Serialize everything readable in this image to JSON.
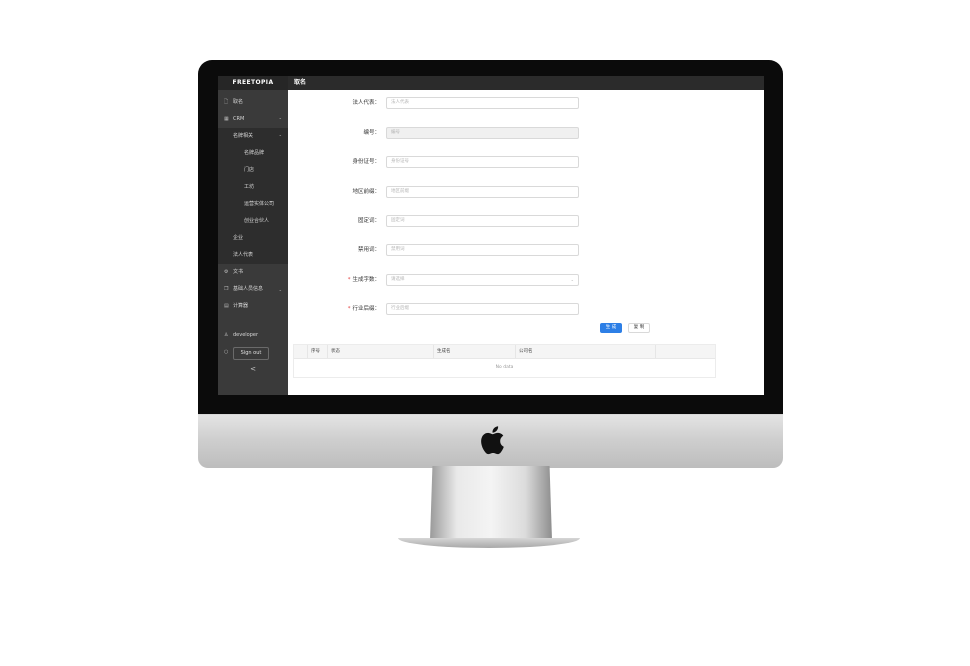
{
  "app": {
    "brand": "FREETOPIA",
    "page_title": "取名"
  },
  "sidebar": {
    "items": [
      {
        "label": "取名",
        "icon": "document-icon"
      },
      {
        "label": "CRM",
        "icon": "grid-icon",
        "expanded": true
      },
      {
        "label": "名牌相关",
        "expanded": true
      },
      {
        "label": "名牌品牌"
      },
      {
        "label": "门店"
      },
      {
        "label": "工坊"
      },
      {
        "label": "运营实体公司"
      },
      {
        "label": "创业合伙人"
      },
      {
        "label": "企业"
      },
      {
        "label": "法人代表"
      },
      {
        "label": "文书",
        "icon": "settings-icon"
      },
      {
        "label": "基础人员信息",
        "icon": "copy-icon",
        "expanded": false
      },
      {
        "label": "计算器",
        "icon": "calculator-icon"
      }
    ],
    "user": "developer",
    "signout": "Sign out",
    "collapse": "<"
  },
  "form": {
    "fields": [
      {
        "label": "法人代表",
        "placeholder": "法人代表",
        "required": false,
        "disabled": false
      },
      {
        "label": "编号",
        "placeholder": "编号",
        "required": false,
        "disabled": true
      },
      {
        "label": "身份证号",
        "placeholder": "身份证号",
        "required": false,
        "disabled": false
      },
      {
        "label": "地区前缀",
        "placeholder": "地区前缀",
        "required": false,
        "disabled": false
      },
      {
        "label": "固定词",
        "placeholder": "固定词",
        "required": false,
        "disabled": false
      },
      {
        "label": "禁用词",
        "placeholder": "禁用词",
        "required": false,
        "disabled": false
      },
      {
        "label": "生成字数",
        "placeholder": "请选择",
        "required": true,
        "disabled": false,
        "type": "select"
      },
      {
        "label": "行业后缀",
        "placeholder": "行业后缀",
        "required": true,
        "disabled": false
      }
    ],
    "generate_button": "生 成",
    "copy_button": "复 制"
  },
  "table": {
    "columns": [
      "序号",
      "状态",
      "生成名",
      "公司名",
      ""
    ],
    "empty_text": "No data"
  },
  "colors": {
    "primary": "#2d7fe6",
    "sidebar": "#3a3a3a",
    "required": "#e23b3b"
  }
}
